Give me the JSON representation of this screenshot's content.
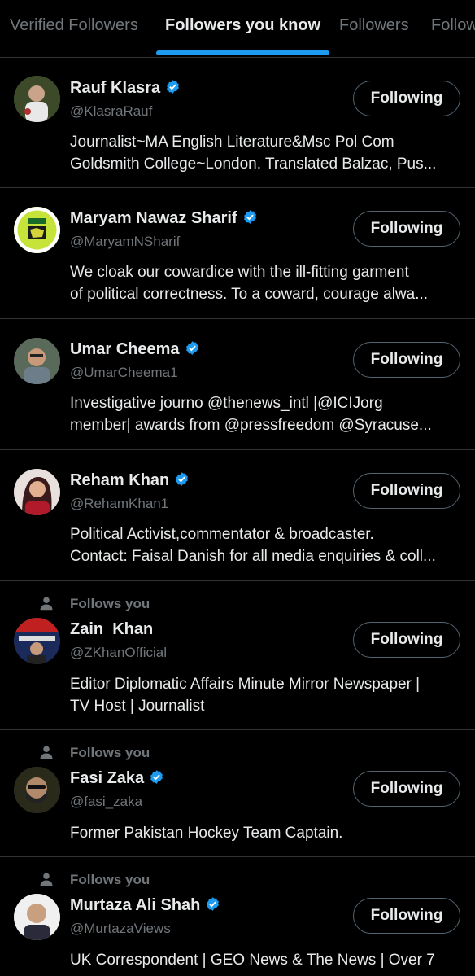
{
  "tabs": [
    {
      "label": "Verified Followers"
    },
    {
      "label": "Followers you know"
    },
    {
      "label": "Followers"
    },
    {
      "label": "Follow"
    }
  ],
  "colors": {
    "accent": "#1d9bf0",
    "background": "#000000",
    "secondary_text": "#71767b"
  },
  "follows_you_label": "Follows you",
  "users": [
    {
      "name": "Rauf Klasra",
      "handle": "@KlasraRauf",
      "verified": true,
      "follows_you": false,
      "button": "Following",
      "bio_line1": "Journalist~MA English Literature&Msc Pol Com",
      "bio_line2": "Goldsmith College~London. Translated Balzac, Pus..."
    },
    {
      "name": "Maryam Nawaz Sharif",
      "handle": "@MaryamNSharif",
      "verified": true,
      "follows_you": false,
      "button": "Following",
      "bio_line1": "We cloak our cowardice with the ill-fitting garment",
      "bio_line2": "of political correctness. To a coward, courage alwa..."
    },
    {
      "name": "Umar Cheema",
      "handle": "@UmarCheema1",
      "verified": true,
      "follows_you": false,
      "button": "Following",
      "bio_line1": "Investigative journo @thenews_intl |@ICIJorg",
      "bio_line2": "member| awards from @pressfreedom @Syracuse..."
    },
    {
      "name": "Reham Khan",
      "handle": "@RehamKhan1",
      "verified": true,
      "follows_you": false,
      "button": "Following",
      "bio_line1": "Political Activist,commentator & broadcaster.",
      "bio_line2": "Contact: Faisal Danish for all media enquiries & coll..."
    },
    {
      "name": "Zain  Khan",
      "handle": "@ZKhanOfficial",
      "verified": false,
      "follows_you": true,
      "button": "Following",
      "bio_line1": "Editor Diplomatic Affairs Minute Mirror Newspaper |",
      "bio_line2": "TV Host | Journalist"
    },
    {
      "name": "Fasi Zaka",
      "handle": "@fasi_zaka",
      "verified": true,
      "follows_you": true,
      "button": "Following",
      "bio_line1": "Former Pakistan Hockey Team Captain.",
      "bio_line2": ""
    },
    {
      "name": "Murtaza Ali Shah",
      "handle": "@MurtazaViews",
      "verified": true,
      "follows_you": true,
      "button": "Following",
      "bio_line1": "UK Correspondent | GEO News & The News | Over 7",
      "bio_line2": ""
    }
  ]
}
